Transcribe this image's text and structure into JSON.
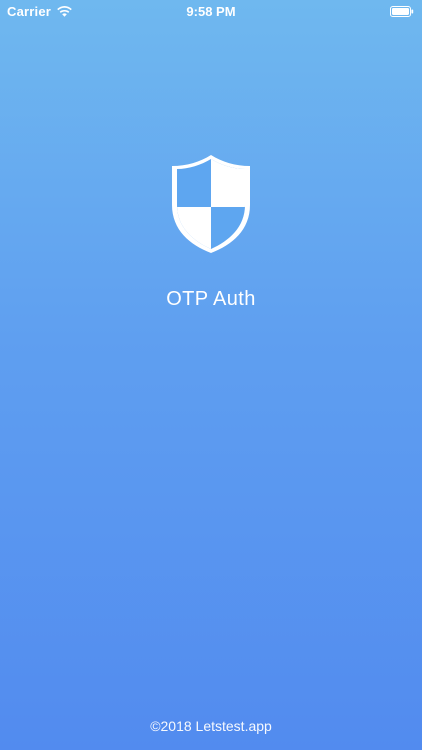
{
  "status_bar": {
    "carrier": "Carrier",
    "time": "9:58 PM",
    "wifi_icon": "wifi-icon",
    "battery_icon": "battery-icon"
  },
  "splash": {
    "logo_icon": "shield-icon",
    "app_title": "OTP Auth",
    "copyright": "©2018 Letstest.app"
  },
  "colors": {
    "background_top": "#6fb8ef",
    "background_bottom": "#528bef",
    "text": "#ffffff"
  }
}
